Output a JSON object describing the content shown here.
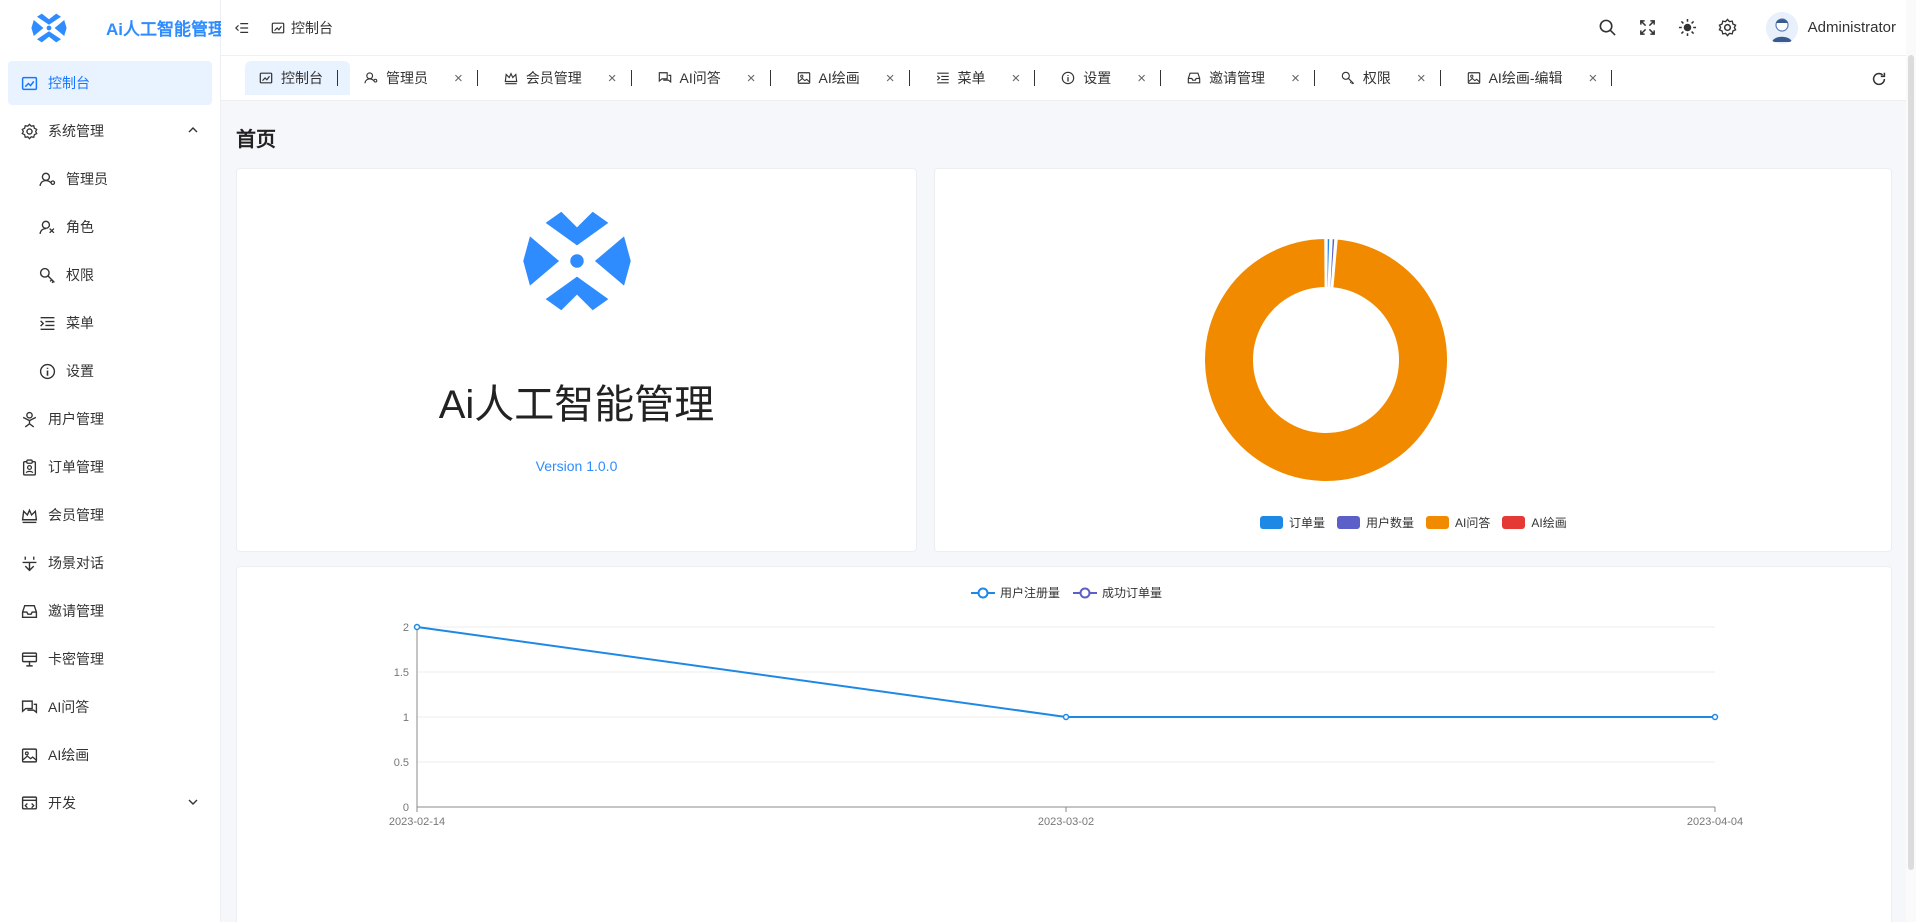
{
  "app": {
    "brand": "Ai人工智能管理"
  },
  "sidebar": {
    "items": [
      {
        "label": "控制台",
        "icon": "dashboard-icon"
      },
      {
        "label": "系统管理",
        "icon": "gear-icon"
      },
      {
        "label": "管理员",
        "icon": "user-admin-icon"
      },
      {
        "label": "角色",
        "icon": "user-role-icon"
      },
      {
        "label": "权限",
        "icon": "key-icon"
      },
      {
        "label": "菜单",
        "icon": "menu-list-icon"
      },
      {
        "label": "设置",
        "icon": "info-icon"
      },
      {
        "label": "用户管理",
        "icon": "users-icon"
      },
      {
        "label": "订单管理",
        "icon": "clipboard-icon"
      },
      {
        "label": "会员管理",
        "icon": "crown-icon"
      },
      {
        "label": "场景对话",
        "icon": "scene-icon"
      },
      {
        "label": "邀请管理",
        "icon": "inbox-icon"
      },
      {
        "label": "卡密管理",
        "icon": "card-icon"
      },
      {
        "label": "AI问答",
        "icon": "chat-icon"
      },
      {
        "label": "AI绘画",
        "icon": "image-icon"
      },
      {
        "label": "开发",
        "icon": "code-icon"
      }
    ]
  },
  "header": {
    "breadcrumb": "控制台",
    "username": "Administrator"
  },
  "tabs": [
    {
      "label": "控制台",
      "icon": "dashboard-icon"
    },
    {
      "label": "管理员",
      "icon": "user-admin-icon"
    },
    {
      "label": "会员管理",
      "icon": "crown-icon"
    },
    {
      "label": "AI问答",
      "icon": "chat-icon"
    },
    {
      "label": "AI绘画",
      "icon": "image-icon"
    },
    {
      "label": "菜单",
      "icon": "menu-list-icon"
    },
    {
      "label": "设置",
      "icon": "info-icon"
    },
    {
      "label": "邀请管理",
      "icon": "inbox-icon"
    },
    {
      "label": "权限",
      "icon": "key-icon"
    },
    {
      "label": "AI绘画-编辑",
      "icon": "image-icon"
    }
  ],
  "tab_close": "×",
  "main": {
    "page_title": "首页",
    "app_name": "Ai人工智能管理",
    "version": "Version 1.0.0"
  },
  "colors": {
    "primary": "#1677ff",
    "brand_blue": "#2f8cff",
    "pie_order": "#1e88e5",
    "pie_users": "#5b5fc7",
    "pie_ai_qa": "#f28a00",
    "pie_ai_draw": "#e53935"
  },
  "chart_data": [
    {
      "type": "pie",
      "donut": true,
      "series": [
        {
          "name": "订单量",
          "value": 1,
          "color": "#1e88e5"
        },
        {
          "name": "用户数量",
          "value": 1,
          "color": "#5b5fc7"
        },
        {
          "name": "AI问答",
          "value": 150,
          "color": "#f28a00"
        },
        {
          "name": "AI绘画",
          "value": 0,
          "color": "#e53935"
        }
      ],
      "legend_position": "bottom"
    },
    {
      "type": "line",
      "x": [
        "2023-02-14",
        "2023-03-02",
        "2023-04-04"
      ],
      "series": [
        {
          "name": "用户注册量",
          "values": [
            2,
            1,
            1
          ],
          "color": "#1e88e5"
        },
        {
          "name": "成功订单量",
          "values": [],
          "color": "#5b5fc7"
        }
      ],
      "ylim": [
        0,
        2
      ],
      "yticks": [
        "0",
        "0.5",
        "1",
        "1.5",
        "2"
      ],
      "grid": true,
      "legend_position": "top"
    }
  ]
}
